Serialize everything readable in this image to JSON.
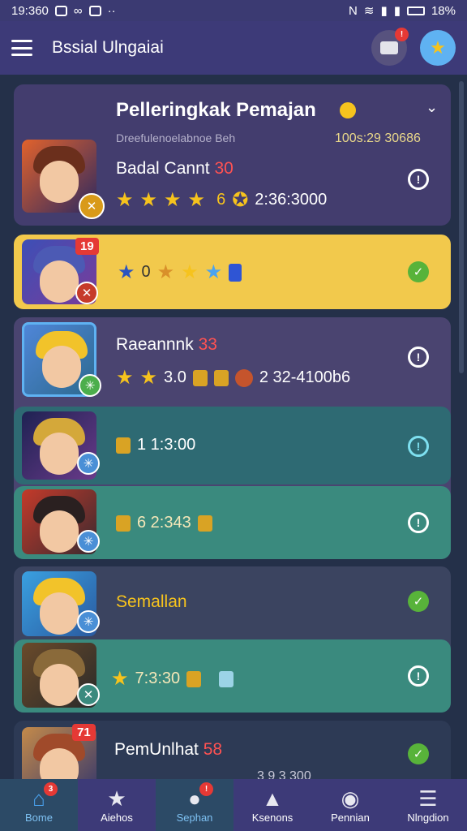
{
  "status_bar": {
    "time": "19:360",
    "battery": "18%"
  },
  "app_bar": {
    "title": "Bssial Ulngaiai",
    "notification_badge": "!"
  },
  "leaderboard": {
    "title": "Pelleringkak Pemajan",
    "subtitle": "Dreefulenoelabnoe Beh",
    "record": "100s:29 30686"
  },
  "players": [
    {
      "name": "Badal Cannt",
      "level": "30",
      "stars": "6",
      "score": "2:36:3000"
    },
    {
      "rank": "19",
      "stars": "0"
    },
    {
      "name": "Raeannnk",
      "level": "33",
      "rating": "3.0",
      "score": "2 32-4100b6"
    },
    {
      "time": "1 1:3:00"
    },
    {
      "time": "6 2:343"
    },
    {
      "name": "Semallan"
    },
    {
      "time": "7:3:30"
    },
    {
      "name": "PemUnlhat",
      "level": "58",
      "rank": "71",
      "score": "3 9 3 300"
    }
  ],
  "bottom_nav": [
    {
      "label": "Bome",
      "icon": "home-icon",
      "badge": "3"
    },
    {
      "label": "Aiehos",
      "icon": "star-icon"
    },
    {
      "label": "Sephan",
      "icon": "blob-icon",
      "badge": "!"
    },
    {
      "label": "Ksenons",
      "icon": "lock-icon"
    },
    {
      "label": "Pennian",
      "icon": "gamepad-icon"
    },
    {
      "label": "Nlngdion",
      "icon": "menu-icon"
    }
  ],
  "colors": {
    "accent": "#f6c31d",
    "highlight_card": "#f2c94c",
    "header": "#3d3a78",
    "teal_card": "#2e6a73",
    "purple_card": "#4a4470"
  }
}
